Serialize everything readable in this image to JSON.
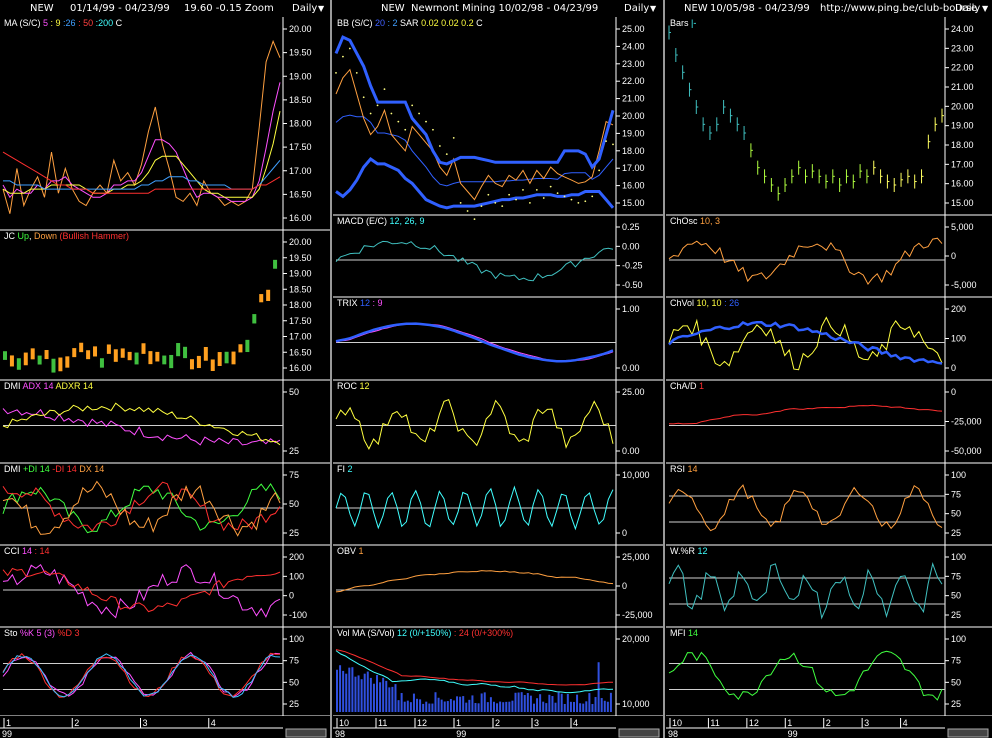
{
  "columns": [
    {
      "header": {
        "ticker": "NEW",
        "range": "01/14/99 - 04/23/99",
        "extra": "19.60  -0.15   Zoom",
        "period": "Daily"
      },
      "panels": [
        {
          "key": "a1",
          "label": [
            [
              "MA",
              ""
            ],
            [
              " (S/C)",
              "#fff"
            ],
            [
              "  5",
              "#ff50ff"
            ],
            [
              " : 9",
              "#ffff40"
            ],
            [
              " :26",
              "#40a0ff"
            ],
            [
              " : 50",
              "#ff4040"
            ],
            [
              " :200",
              "#40ffff"
            ],
            [
              "    C ",
              "#fff"
            ],
            [
              "",
              ""
            ]
          ],
          "ticks": [
            "20.00",
            "19.50",
            "19.00",
            "18.50",
            "18.00",
            "17.50",
            "17.00",
            "16.50",
            "16.00"
          ]
        },
        {
          "key": "a2",
          "label": [
            [
              "JC ",
              "#fff"
            ],
            [
              "Up",
              "#40ff40"
            ],
            [
              ", ",
              "#fff"
            ],
            [
              "Down",
              "#ffa040"
            ],
            [
              "  (Bullish Hammer)",
              "#ff3030"
            ]
          ],
          "ticks": [
            "20.00",
            "19.50",
            "19.00",
            "18.50",
            "18.00",
            "17.50",
            "17.00",
            "16.50",
            "16.00"
          ]
        },
        {
          "key": "a3",
          "label": [
            [
              "DMI ",
              "#fff"
            ],
            [
              "ADX 14",
              "#ff50ff"
            ],
            [
              "  ADXR 14",
              "#ffff40"
            ]
          ],
          "ticks": [
            "50",
            "25"
          ]
        },
        {
          "key": "a4",
          "label": [
            [
              "DMI ",
              "#fff"
            ],
            [
              "+DI 14",
              "#40ff40"
            ],
            [
              "  -DI 14",
              "#ff3030"
            ],
            [
              "  DX 14",
              "#ffa040"
            ]
          ],
          "ticks": [
            "75",
            "50",
            "25"
          ]
        },
        {
          "key": "a5",
          "label": [
            [
              "CCI ",
              "#fff"
            ],
            [
              "14",
              "#ff50ff"
            ],
            [
              " : 14",
              "#ff3030"
            ]
          ],
          "ticks": [
            "200",
            "100",
            "0",
            "-100"
          ]
        },
        {
          "key": "a6",
          "label": [
            [
              "Sto ",
              "#fff"
            ],
            [
              "%K 5 (3)",
              "#ff50ff"
            ],
            [
              "  %D 3",
              "#ff3030"
            ]
          ],
          "ticks": [
            "100",
            "75",
            "50",
            "25"
          ]
        }
      ],
      "xaxis": {
        "months": [
          "1",
          "2",
          "3",
          "4"
        ],
        "year": "99"
      }
    },
    {
      "header": {
        "ticker": "NEW",
        "range": "Newmont Mining  10/02/98 - 04/23/99",
        "extra": "",
        "period": "Daily"
      },
      "panels": [
        {
          "key": "b1",
          "label": [
            [
              "BB ",
              "#fff"
            ],
            [
              "(S/C)",
              "#fff"
            ],
            [
              "  20",
              "#4060ff"
            ],
            [
              " : 2",
              "#40a0ff"
            ],
            [
              "   SAR ",
              "#fff"
            ],
            [
              " 0.02",
              "#ffff40"
            ],
            [
              "  0.02",
              "#ffff40"
            ],
            [
              "  0.2",
              "#ffff40"
            ],
            [
              "   C ",
              "#fff"
            ]
          ],
          "ticks": [
            "25.00",
            "24.00",
            "23.00",
            "22.00",
            "21.00",
            "20.00",
            "19.00",
            "18.00",
            "17.00",
            "16.00",
            "15.00"
          ]
        },
        {
          "key": "b2",
          "label": [
            [
              "MACD (E/C)",
              "#fff"
            ],
            [
              "  12, 26, 9",
              "#40ffff"
            ]
          ],
          "ticks": [
            "0.25",
            "0.00",
            "-0.25",
            "-0.50"
          ]
        },
        {
          "key": "b3",
          "label": [
            [
              "TRIX ",
              "#fff"
            ],
            [
              "12",
              "#3060ff"
            ],
            [
              " : 9",
              "#ff50ff"
            ]
          ],
          "ticks": [
            "1.00",
            "0.00"
          ]
        },
        {
          "key": "b4",
          "label": [
            [
              "ROC ",
              "#fff"
            ],
            [
              "12",
              "#ffff40"
            ]
          ],
          "ticks": [
            "25.00",
            "0.00"
          ]
        },
        {
          "key": "b5",
          "label": [
            [
              "FI ",
              "#fff"
            ],
            [
              "2",
              "#40ffff"
            ]
          ],
          "ticks": [
            "10,000",
            "0"
          ]
        },
        {
          "key": "b6",
          "label": [
            [
              "OBV ",
              "#fff"
            ],
            [
              "1",
              "#ffa040"
            ]
          ],
          "ticks": [
            "25,000",
            "0",
            "-25,000"
          ]
        },
        {
          "key": "b7",
          "label": [
            [
              "Vol ",
              "#fff"
            ],
            [
              "  MA (S/Vol)",
              "#fff"
            ],
            [
              "  12 (0/+150%)",
              "#40ffff"
            ],
            [
              " : 24 (0/+300%)",
              "#ff3030"
            ]
          ],
          "ticks": [
            "20,000",
            "10,000"
          ]
        }
      ],
      "xaxis": {
        "months": [
          "10",
          "11",
          "12",
          "1",
          "2",
          "3",
          "4"
        ],
        "year1": "98",
        "year2": "99"
      }
    },
    {
      "header": {
        "ticker": "NEW",
        "range": "10/05/98 - 04/23/99",
        "extra": "http://www.ping.be/club-bourse",
        "period": "Daily"
      },
      "panels": [
        {
          "key": "c1",
          "label": [
            [
              "Bars",
              "#fff"
            ],
            [
              "  |-",
              "#40ffff"
            ]
          ],
          "ticks": [
            "24.00",
            "23.00",
            "22.00",
            "21.00",
            "20.00",
            "19.00",
            "18.00",
            "17.00",
            "16.00",
            "15.00"
          ]
        },
        {
          "key": "c2",
          "label": [
            [
              "ChOsc ",
              "#fff"
            ],
            [
              " 10, 3",
              "#ffa040"
            ]
          ],
          "ticks": [
            "5,000",
            "0",
            "-5,000"
          ]
        },
        {
          "key": "c3",
          "label": [
            [
              "ChVol ",
              "#fff"
            ],
            [
              " 10, 10",
              "#ffff40"
            ],
            [
              " : 26",
              "#3060ff"
            ]
          ],
          "ticks": [
            "200",
            "100",
            "0"
          ]
        },
        {
          "key": "c4",
          "label": [
            [
              "ChA/D ",
              "#fff"
            ],
            [
              " 1",
              "#ff3030"
            ]
          ],
          "ticks": [
            "0",
            "-25,000",
            "-50,000"
          ]
        },
        {
          "key": "c5",
          "label": [
            [
              "RSI ",
              "#fff"
            ],
            [
              " 14",
              "#ffa040"
            ]
          ],
          "ticks": [
            "100",
            "75",
            "50",
            "25"
          ]
        },
        {
          "key": "c6",
          "label": [
            [
              "W.%R ",
              "#fff"
            ],
            [
              " 12",
              "#40ffff"
            ]
          ],
          "ticks": [
            "100",
            "75",
            "50",
            "25"
          ]
        },
        {
          "key": "c7",
          "label": [
            [
              "MFI ",
              "#fff"
            ],
            [
              " 14",
              "#40ff40"
            ]
          ],
          "ticks": [
            "100",
            "75",
            "50",
            "25"
          ]
        }
      ],
      "xaxis": {
        "months": [
          "10",
          "11",
          "12",
          "1",
          "2",
          "3",
          "4"
        ],
        "year1": "98",
        "year2": "99"
      }
    }
  ],
  "chart_data": [
    {
      "type": "line",
      "title": "NEW 01/14/99 - 04/23/99 MA (S/C)",
      "ylim": [
        15.5,
        20.3
      ],
      "series": [
        {
          "name": "C",
          "values": [
            16.4,
            15.8,
            16.9,
            16.0,
            16.4,
            16.7,
            16.2,
            17.3,
            16.3,
            16.9,
            16.4,
            16.1,
            16.0,
            16.3,
            16.5,
            16.3,
            17.1,
            16.6,
            16.8,
            16.5,
            17.0,
            17.8,
            18.4,
            17.5,
            16.9,
            16.2,
            16.1,
            16.3,
            16.0,
            16.6,
            16.3,
            16.2,
            16.0,
            16.1,
            16.0,
            16.1,
            16.4,
            17.9,
            19.5,
            20.0,
            19.6
          ]
        },
        {
          "name": "5",
          "values": [
            16.5,
            16.2,
            16.4,
            16.3,
            16.3,
            16.5,
            16.4,
            16.6,
            16.6,
            16.7,
            16.5,
            16.4,
            16.3,
            16.2,
            16.2,
            16.3,
            16.5,
            16.5,
            16.6,
            16.6,
            16.8,
            17.2,
            17.6,
            17.6,
            17.5,
            17.3,
            16.9,
            16.5,
            16.2,
            16.3,
            16.3,
            16.2,
            16.2,
            16.1,
            16.1,
            16.1,
            16.2,
            16.6,
            17.4,
            18.3,
            19.0
          ]
        },
        {
          "name": "9",
          "values": [
            16.4,
            16.3,
            16.3,
            16.3,
            16.4,
            16.4,
            16.4,
            16.5,
            16.5,
            16.5,
            16.5,
            16.5,
            16.4,
            16.3,
            16.3,
            16.3,
            16.4,
            16.4,
            16.5,
            16.5,
            16.6,
            16.8,
            17.1,
            17.2,
            17.2,
            17.2,
            17.0,
            16.8,
            16.6,
            16.4,
            16.3,
            16.3,
            16.2,
            16.2,
            16.2,
            16.2,
            16.2,
            16.4,
            16.9,
            17.5,
            18.3
          ]
        },
        {
          "name": "26",
          "values": [
            16.6,
            16.6,
            16.5,
            16.5,
            16.5,
            16.5,
            16.4,
            16.4,
            16.4,
            16.4,
            16.4,
            16.4,
            16.4,
            16.4,
            16.4,
            16.4,
            16.4,
            16.4,
            16.4,
            16.4,
            16.5,
            16.5,
            16.6,
            16.6,
            16.7,
            16.7,
            16.7,
            16.6,
            16.6,
            16.5,
            16.5,
            16.5,
            16.5,
            16.4,
            16.4,
            16.4,
            16.4,
            16.5,
            16.7,
            16.9,
            17.1
          ]
        },
        {
          "name": "50",
          "values": [
            17.3,
            17.2,
            17.1,
            17.0,
            16.9,
            16.8,
            16.7,
            16.6,
            16.5,
            16.5,
            16.4,
            16.4,
            16.4,
            16.3,
            16.3,
            16.3,
            16.3,
            16.3,
            16.3,
            16.3,
            16.3,
            16.3,
            16.4,
            16.4,
            16.4,
            16.4,
            16.4,
            16.4,
            16.4,
            16.4,
            16.4,
            16.4,
            16.4,
            16.4,
            16.4,
            16.4,
            16.4,
            16.5,
            16.5,
            16.6,
            16.7
          ]
        }
      ]
    },
    {
      "type": "line",
      "title": "Newmont Mining 10/02/98 - 04/23/99 BB (S/C)",
      "ylim": [
        14.3,
        25.5
      ],
      "series": [
        {
          "name": "Close",
          "values": [
            21.5,
            22.5,
            23.0,
            21.5,
            20.0,
            19.0,
            19.5,
            20.5,
            19.0,
            18.5,
            18.0,
            19.5,
            19.0,
            18.5,
            18.0,
            17.0,
            16.5,
            17.5,
            16.0,
            15.5,
            15.0,
            15.8,
            16.5,
            16.0,
            15.8,
            16.5,
            16.2,
            16.8,
            16.0,
            16.8,
            16.3,
            17.0,
            16.6,
            16.4,
            16.2,
            16.0,
            16.1,
            16.4,
            18.0,
            19.8,
            19.6
          ]
        },
        {
          "name": "Upper",
          "values": [
            24.0,
            25.0,
            24.8,
            24.0,
            23.2,
            22.0,
            21.0,
            21.0,
            21.0,
            21.0,
            21.0,
            20.0,
            19.5,
            19.0,
            18.0,
            17.3,
            17.2,
            17.4,
            17.6,
            17.6,
            17.6,
            17.5,
            17.4,
            17.3,
            17.3,
            17.3,
            17.3,
            17.3,
            17.3,
            17.3,
            17.3,
            17.3,
            17.3,
            18.0,
            18.0,
            18.0,
            17.8,
            17.0,
            17.5,
            19.0,
            20.5
          ]
        },
        {
          "name": "Lower",
          "values": [
            15.5,
            15.2,
            15.6,
            16.2,
            17.0,
            17.5,
            17.2,
            17.2,
            17.0,
            16.8,
            16.3,
            16.0,
            15.5,
            15.0,
            14.8,
            14.6,
            14.5,
            14.6,
            14.6,
            14.6,
            14.6,
            14.7,
            14.8,
            14.9,
            15.0,
            15.0,
            15.1,
            15.1,
            15.2,
            15.3,
            15.3,
            15.3,
            15.2,
            15.2,
            15.3,
            15.3,
            15.5,
            15.5,
            15.5,
            15.0,
            14.5
          ]
        }
      ]
    },
    {
      "type": "bar",
      "title": "NEW 10/05/98 - 04/23/99 Bars",
      "ylim": [
        14.5,
        25.0
      ],
      "values": [
        24.8,
        23.5,
        22.5,
        21.5,
        20.5,
        19.5,
        19.0,
        19.5,
        20.5,
        20.0,
        19.5,
        19.0,
        18.0,
        17.0,
        16.5,
        16.0,
        15.5,
        16.0,
        16.5,
        17.0,
        16.5,
        16.8,
        16.5,
        16.2,
        16.5,
        16.0,
        16.5,
        16.2,
        16.8,
        16.5,
        17.0,
        16.5,
        16.2,
        16.0,
        16.3,
        16.5,
        16.2,
        16.5,
        18.5,
        19.5,
        20.0
      ]
    }
  ]
}
